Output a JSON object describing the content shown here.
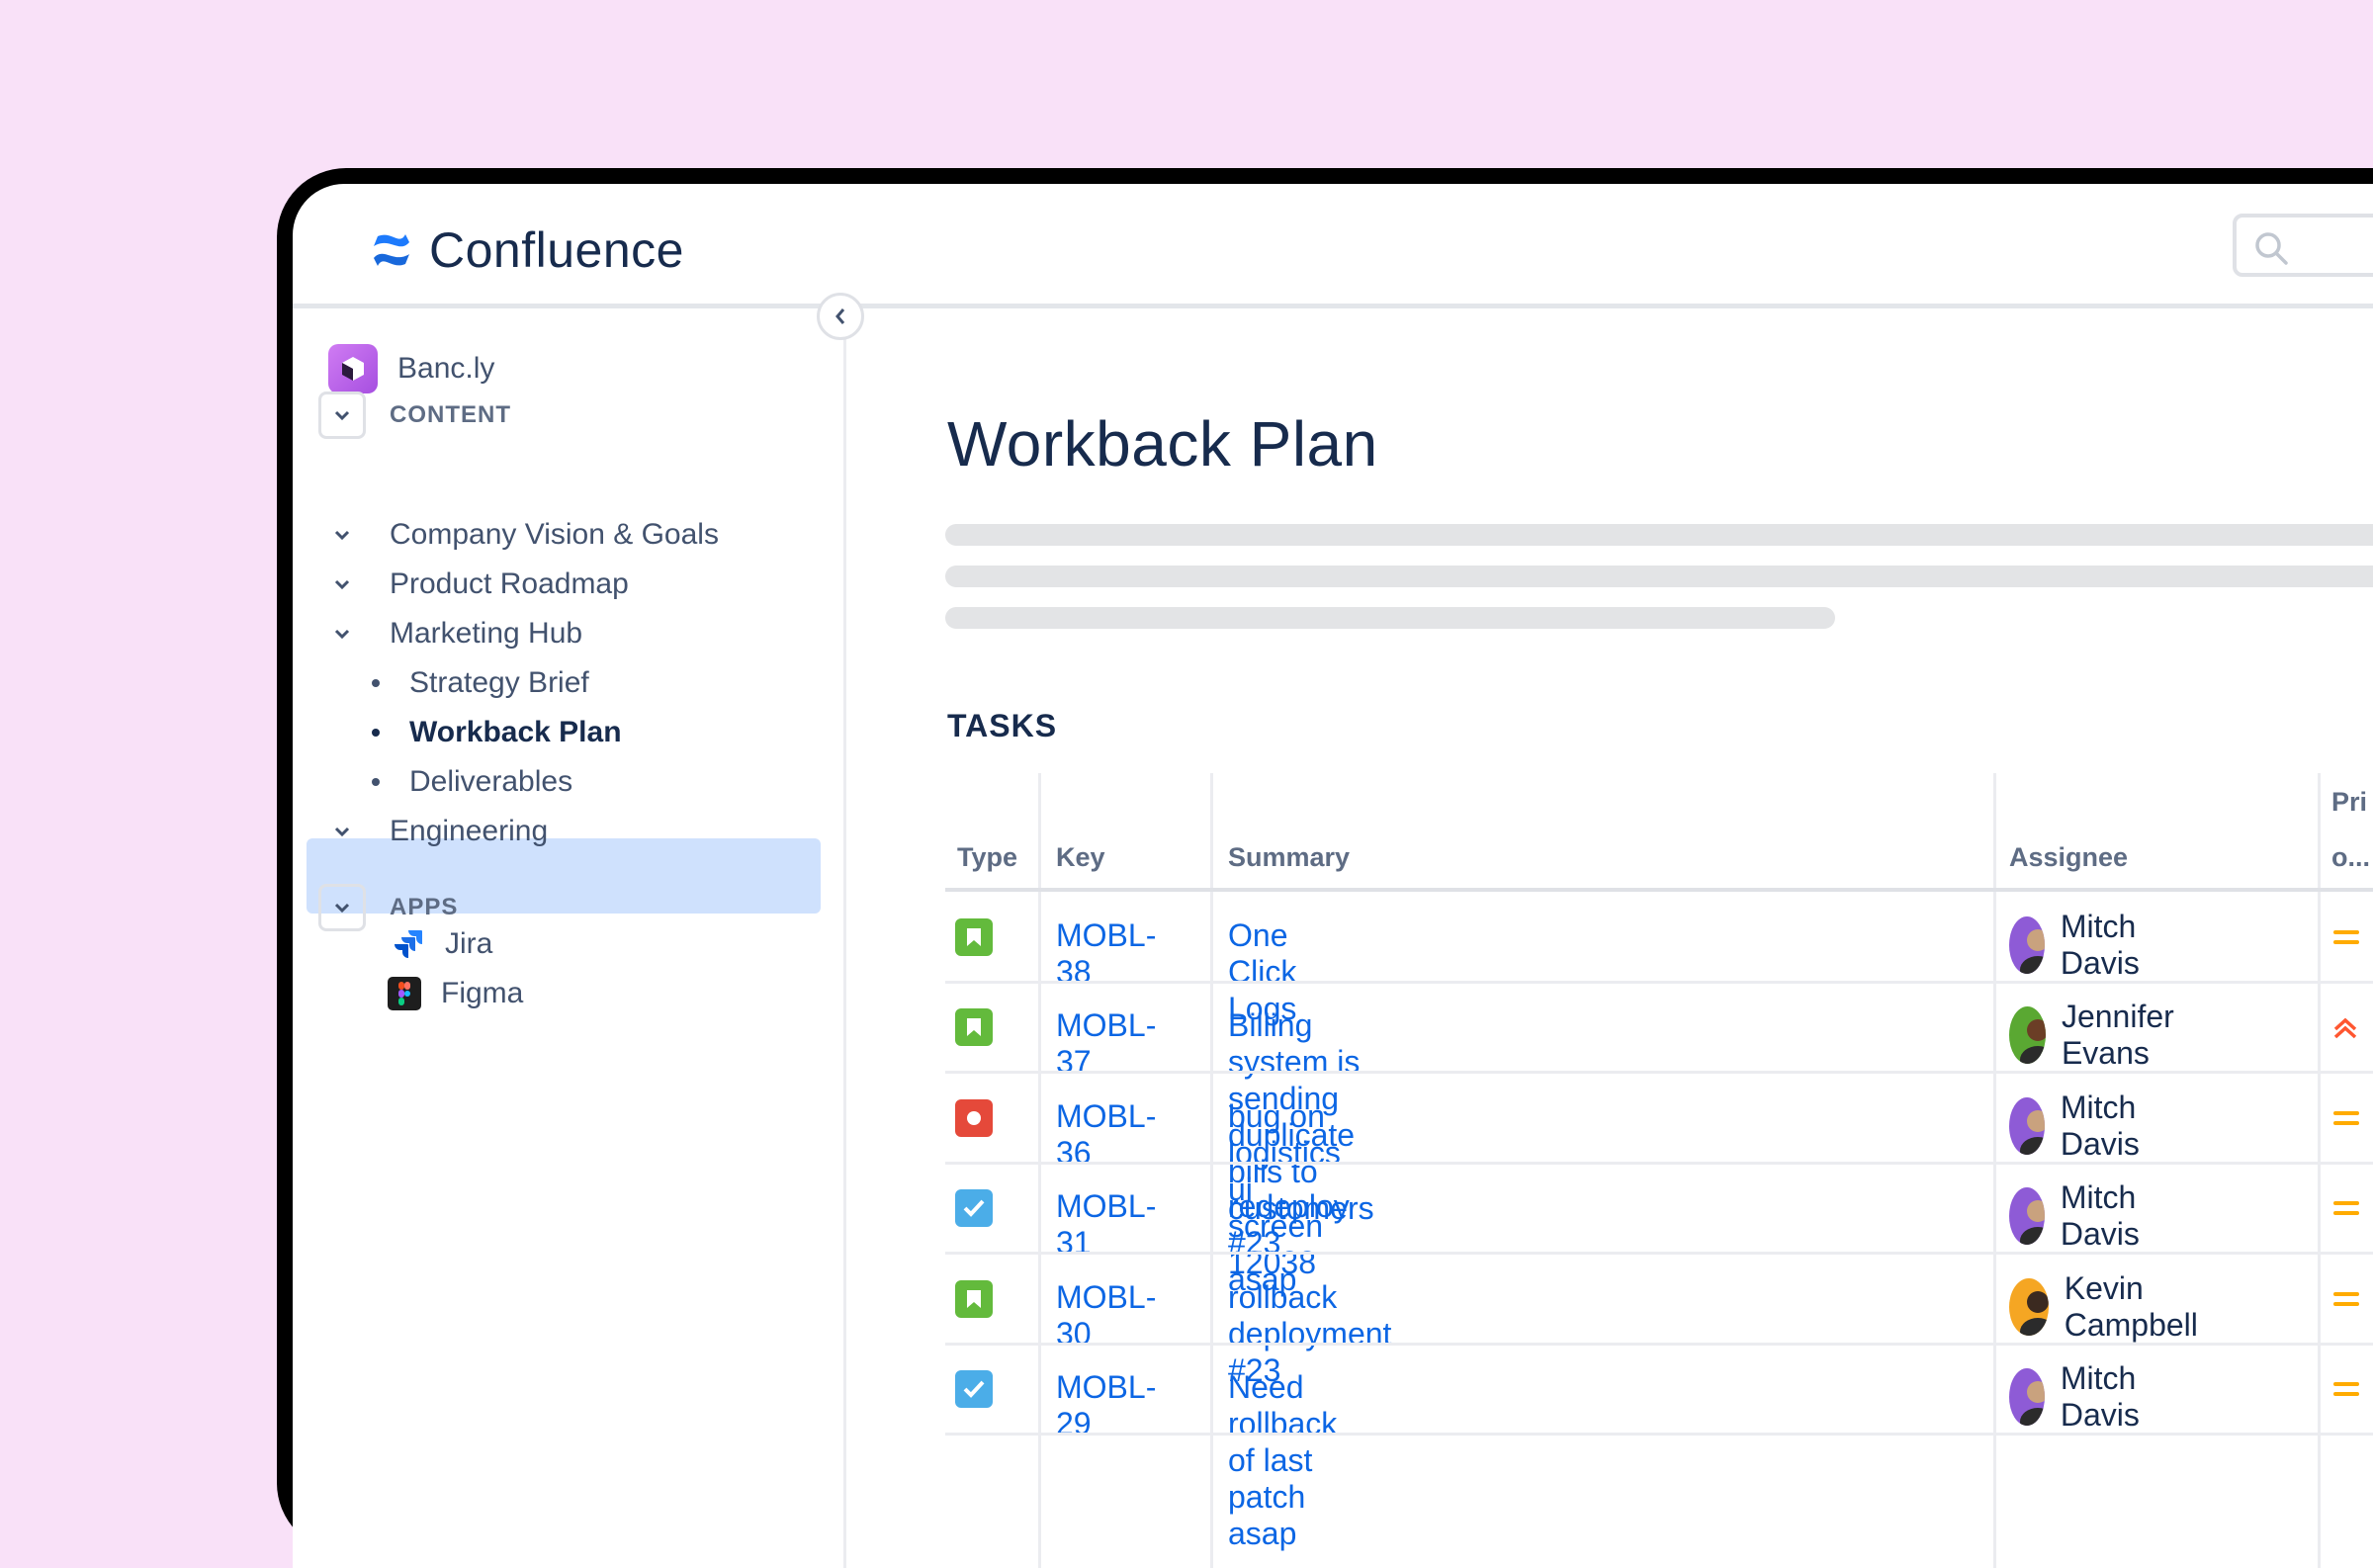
{
  "app": {
    "name": "Confluence"
  },
  "search": {
    "placeholder": ""
  },
  "sidebar": {
    "space_name": "Banc.ly",
    "content_label": "CONTENT",
    "apps_label": "APPS",
    "items": [
      {
        "label": "Company Vision & Goals"
      },
      {
        "label": "Product Roadmap"
      },
      {
        "label": "Marketing Hub"
      },
      {
        "label": "Engineering"
      }
    ],
    "children": [
      {
        "label": "Strategy Brief"
      },
      {
        "label": "Workback Plan"
      },
      {
        "label": "Deliverables"
      }
    ],
    "apps": [
      {
        "label": "Jira",
        "icon": "jira-icon"
      },
      {
        "label": "Figma",
        "icon": "figma-icon"
      }
    ],
    "selected": "Workback Plan"
  },
  "page": {
    "title": "Workback Plan",
    "tasks_heading": "TASKS"
  },
  "table": {
    "headers": {
      "type": "Type",
      "key": "Key",
      "summary": "Summary",
      "assignee": "Assignee",
      "priority_line1": "Pri",
      "priority_line2": "o..."
    },
    "rows": [
      {
        "type": "story",
        "key": "MOBL-38",
        "summary": "One Click Logs",
        "assignee": "Mitch Davis",
        "priority": "medium"
      },
      {
        "type": "story",
        "key": "MOBL-37",
        "summary": "Billing system is sending duplicate bills to customers",
        "assignee": "Jennifer Evans",
        "priority": "high"
      },
      {
        "type": "bug",
        "key": "MOBL-36",
        "summary": "bug on logistics ui screen 12038",
        "assignee": "Mitch Davis",
        "priority": "medium"
      },
      {
        "type": "task",
        "key": "MOBL-31",
        "summary": "redeploy #23 asap",
        "assignee": "Mitch Davis",
        "priority": "medium"
      },
      {
        "type": "story",
        "key": "MOBL-30",
        "summary": "rollback deployment #23",
        "assignee": "Kevin Campbell",
        "priority": "medium"
      },
      {
        "type": "task",
        "key": "MOBL-29",
        "summary": "Need rollback of last patch asap",
        "assignee": "Mitch Davis",
        "priority": "medium"
      }
    ]
  },
  "colors": {
    "background": "#f9e1f8",
    "link": "#0c66e4",
    "story": "#63ba3c",
    "bug": "#e5493a",
    "task": "#4bade8",
    "priority_medium": "#ffab00",
    "priority_high": "#ff5630",
    "selected": "#cfe1fd"
  }
}
